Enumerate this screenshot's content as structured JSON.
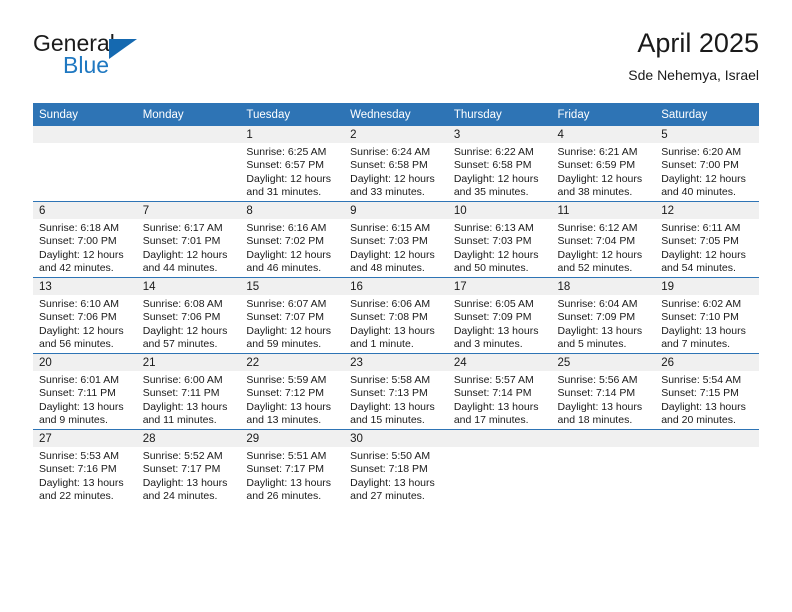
{
  "brand": {
    "line1": "General",
    "line2": "Blue",
    "triangle_color": "#1569b0",
    "blue_text_color": "#1f78c1"
  },
  "header": {
    "title": "April 2025",
    "subtitle": "Sde Nehemya, Israel",
    "header_bar_color": "#2e74b5",
    "daystrip_color": "#f0f0f0"
  },
  "weekday_headers": [
    "Sunday",
    "Monday",
    "Tuesday",
    "Wednesday",
    "Thursday",
    "Friday",
    "Saturday"
  ],
  "labels": {
    "sunrise": "Sunrise:",
    "sunset": "Sunset:",
    "daylight": "Daylight:"
  },
  "weeks": [
    [
      {
        "day": "",
        "empty": true
      },
      {
        "day": "",
        "empty": true
      },
      {
        "day": "1",
        "sunrise": "Sunrise: 6:25 AM",
        "sunset": "Sunset: 6:57 PM",
        "daylight1": "Daylight: 12 hours",
        "daylight2": "and 31 minutes."
      },
      {
        "day": "2",
        "sunrise": "Sunrise: 6:24 AM",
        "sunset": "Sunset: 6:58 PM",
        "daylight1": "Daylight: 12 hours",
        "daylight2": "and 33 minutes."
      },
      {
        "day": "3",
        "sunrise": "Sunrise: 6:22 AM",
        "sunset": "Sunset: 6:58 PM",
        "daylight1": "Daylight: 12 hours",
        "daylight2": "and 35 minutes."
      },
      {
        "day": "4",
        "sunrise": "Sunrise: 6:21 AM",
        "sunset": "Sunset: 6:59 PM",
        "daylight1": "Daylight: 12 hours",
        "daylight2": "and 38 minutes."
      },
      {
        "day": "5",
        "sunrise": "Sunrise: 6:20 AM",
        "sunset": "Sunset: 7:00 PM",
        "daylight1": "Daylight: 12 hours",
        "daylight2": "and 40 minutes."
      }
    ],
    [
      {
        "day": "6",
        "sunrise": "Sunrise: 6:18 AM",
        "sunset": "Sunset: 7:00 PM",
        "daylight1": "Daylight: 12 hours",
        "daylight2": "and 42 minutes."
      },
      {
        "day": "7",
        "sunrise": "Sunrise: 6:17 AM",
        "sunset": "Sunset: 7:01 PM",
        "daylight1": "Daylight: 12 hours",
        "daylight2": "and 44 minutes."
      },
      {
        "day": "8",
        "sunrise": "Sunrise: 6:16 AM",
        "sunset": "Sunset: 7:02 PM",
        "daylight1": "Daylight: 12 hours",
        "daylight2": "and 46 minutes."
      },
      {
        "day": "9",
        "sunrise": "Sunrise: 6:15 AM",
        "sunset": "Sunset: 7:03 PM",
        "daylight1": "Daylight: 12 hours",
        "daylight2": "and 48 minutes."
      },
      {
        "day": "10",
        "sunrise": "Sunrise: 6:13 AM",
        "sunset": "Sunset: 7:03 PM",
        "daylight1": "Daylight: 12 hours",
        "daylight2": "and 50 minutes."
      },
      {
        "day": "11",
        "sunrise": "Sunrise: 6:12 AM",
        "sunset": "Sunset: 7:04 PM",
        "daylight1": "Daylight: 12 hours",
        "daylight2": "and 52 minutes."
      },
      {
        "day": "12",
        "sunrise": "Sunrise: 6:11 AM",
        "sunset": "Sunset: 7:05 PM",
        "daylight1": "Daylight: 12 hours",
        "daylight2": "and 54 minutes."
      }
    ],
    [
      {
        "day": "13",
        "sunrise": "Sunrise: 6:10 AM",
        "sunset": "Sunset: 7:06 PM",
        "daylight1": "Daylight: 12 hours",
        "daylight2": "and 56 minutes."
      },
      {
        "day": "14",
        "sunrise": "Sunrise: 6:08 AM",
        "sunset": "Sunset: 7:06 PM",
        "daylight1": "Daylight: 12 hours",
        "daylight2": "and 57 minutes."
      },
      {
        "day": "15",
        "sunrise": "Sunrise: 6:07 AM",
        "sunset": "Sunset: 7:07 PM",
        "daylight1": "Daylight: 12 hours",
        "daylight2": "and 59 minutes."
      },
      {
        "day": "16",
        "sunrise": "Sunrise: 6:06 AM",
        "sunset": "Sunset: 7:08 PM",
        "daylight1": "Daylight: 13 hours",
        "daylight2": "and 1 minute."
      },
      {
        "day": "17",
        "sunrise": "Sunrise: 6:05 AM",
        "sunset": "Sunset: 7:09 PM",
        "daylight1": "Daylight: 13 hours",
        "daylight2": "and 3 minutes."
      },
      {
        "day": "18",
        "sunrise": "Sunrise: 6:04 AM",
        "sunset": "Sunset: 7:09 PM",
        "daylight1": "Daylight: 13 hours",
        "daylight2": "and 5 minutes."
      },
      {
        "day": "19",
        "sunrise": "Sunrise: 6:02 AM",
        "sunset": "Sunset: 7:10 PM",
        "daylight1": "Daylight: 13 hours",
        "daylight2": "and 7 minutes."
      }
    ],
    [
      {
        "day": "20",
        "sunrise": "Sunrise: 6:01 AM",
        "sunset": "Sunset: 7:11 PM",
        "daylight1": "Daylight: 13 hours",
        "daylight2": "and 9 minutes."
      },
      {
        "day": "21",
        "sunrise": "Sunrise: 6:00 AM",
        "sunset": "Sunset: 7:11 PM",
        "daylight1": "Daylight: 13 hours",
        "daylight2": "and 11 minutes."
      },
      {
        "day": "22",
        "sunrise": "Sunrise: 5:59 AM",
        "sunset": "Sunset: 7:12 PM",
        "daylight1": "Daylight: 13 hours",
        "daylight2": "and 13 minutes."
      },
      {
        "day": "23",
        "sunrise": "Sunrise: 5:58 AM",
        "sunset": "Sunset: 7:13 PM",
        "daylight1": "Daylight: 13 hours",
        "daylight2": "and 15 minutes."
      },
      {
        "day": "24",
        "sunrise": "Sunrise: 5:57 AM",
        "sunset": "Sunset: 7:14 PM",
        "daylight1": "Daylight: 13 hours",
        "daylight2": "and 17 minutes."
      },
      {
        "day": "25",
        "sunrise": "Sunrise: 5:56 AM",
        "sunset": "Sunset: 7:14 PM",
        "daylight1": "Daylight: 13 hours",
        "daylight2": "and 18 minutes."
      },
      {
        "day": "26",
        "sunrise": "Sunrise: 5:54 AM",
        "sunset": "Sunset: 7:15 PM",
        "daylight1": "Daylight: 13 hours",
        "daylight2": "and 20 minutes."
      }
    ],
    [
      {
        "day": "27",
        "sunrise": "Sunrise: 5:53 AM",
        "sunset": "Sunset: 7:16 PM",
        "daylight1": "Daylight: 13 hours",
        "daylight2": "and 22 minutes."
      },
      {
        "day": "28",
        "sunrise": "Sunrise: 5:52 AM",
        "sunset": "Sunset: 7:17 PM",
        "daylight1": "Daylight: 13 hours",
        "daylight2": "and 24 minutes."
      },
      {
        "day": "29",
        "sunrise": "Sunrise: 5:51 AM",
        "sunset": "Sunset: 7:17 PM",
        "daylight1": "Daylight: 13 hours",
        "daylight2": "and 26 minutes."
      },
      {
        "day": "30",
        "sunrise": "Sunrise: 5:50 AM",
        "sunset": "Sunset: 7:18 PM",
        "daylight1": "Daylight: 13 hours",
        "daylight2": "and 27 minutes."
      },
      {
        "day": "",
        "empty": true
      },
      {
        "day": "",
        "empty": true
      },
      {
        "day": "",
        "empty": true
      }
    ]
  ]
}
